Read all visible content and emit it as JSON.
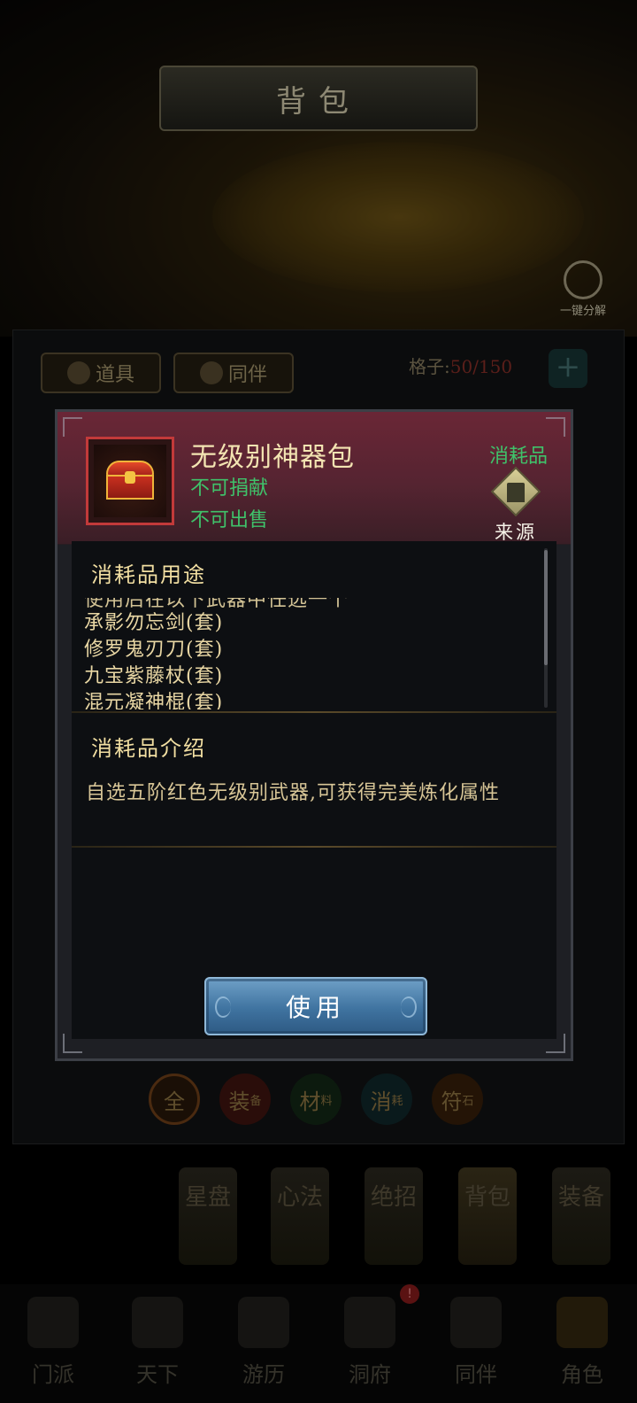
{
  "header": {
    "title": "背包",
    "decompose_label": "一键分解"
  },
  "bag": {
    "tabs": [
      {
        "label": "道具"
      },
      {
        "label": "同伴"
      }
    ],
    "slots_label": "格子:",
    "slots_value": "50/150",
    "add_symbol": "+"
  },
  "filters": [
    {
      "label": "全",
      "sub": ""
    },
    {
      "label": "装",
      "sub": "备"
    },
    {
      "label": "材",
      "sub": "料"
    },
    {
      "label": "消",
      "sub": "耗"
    },
    {
      "label": "符",
      "sub": "石"
    }
  ],
  "side_menu": [
    "星盘",
    "心法",
    "绝招",
    "背包",
    "装备"
  ],
  "bottom_nav": {
    "items": [
      "门派",
      "天下",
      "游历",
      "洞府",
      "同伴",
      "角色"
    ],
    "alert_badge": "!"
  },
  "item_detail": {
    "name": "无级别神器包",
    "type": "消耗品",
    "flags": [
      "不可捐献",
      "不可出售"
    ],
    "source_label": "来源",
    "usage_title": "消耗品用途",
    "usage_lines": [
      "使用后在以下武器中任选一个",
      "承影勿忘剑(套)",
      "修罗鬼刃刀(套)",
      "九宝紫藤杖(套)",
      "混元凝神棍(套)"
    ],
    "intro_title": "消耗品介绍",
    "intro_text": "自选五阶红色无级别武器,可获得完美炼化属性",
    "use_button": "使用"
  },
  "colors": {
    "modal_header": "#6a2636",
    "item_frame": "#c23a3a",
    "flag_green": "#3fc26a",
    "text_gold": "#f2dfa2",
    "use_button": "#3f73a0"
  },
  "icons": {
    "item": "red-treasure-chest-icon",
    "source": "pagoda-diamond-icon"
  }
}
